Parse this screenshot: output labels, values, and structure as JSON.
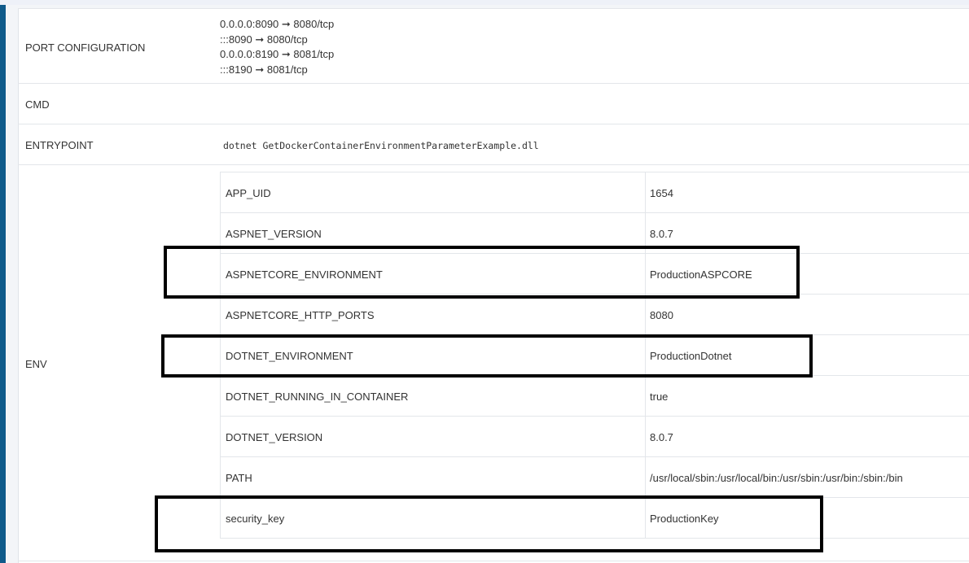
{
  "config": {
    "port_configuration": {
      "label": "PORT CONFIGURATION",
      "lines": [
        "0.0.0.0:8090 ➞ 8080/tcp",
        ":::8090 ➞ 8080/tcp",
        "0.0.0.0:8190 ➞ 8081/tcp",
        ":::8190 ➞ 8081/tcp"
      ]
    },
    "cmd": {
      "label": "CMD",
      "value": ""
    },
    "entrypoint": {
      "label": "ENTRYPOINT",
      "value": "dotnet GetDockerContainerEnvironmentParameterExample.dll"
    },
    "env": {
      "label": "ENV",
      "rows": [
        {
          "name": "APP_UID",
          "value": "1654"
        },
        {
          "name": "ASPNET_VERSION",
          "value": "8.0.7"
        },
        {
          "name": "ASPNETCORE_ENVIRONMENT",
          "value": "ProductionASPCORE"
        },
        {
          "name": "ASPNETCORE_HTTP_PORTS",
          "value": "8080"
        },
        {
          "name": "DOTNET_ENVIRONMENT",
          "value": "ProductionDotnet"
        },
        {
          "name": "DOTNET_RUNNING_IN_CONTAINER",
          "value": "true"
        },
        {
          "name": "DOTNET_VERSION",
          "value": "8.0.7"
        },
        {
          "name": "PATH",
          "value": "/usr/local/sbin:/usr/local/bin:/usr/sbin:/usr/bin:/sbin:/bin"
        },
        {
          "name": "security_key",
          "value": "ProductionKey"
        }
      ]
    }
  },
  "colors": {
    "sidebar_accent": "#0f5a8a",
    "border": "#e3e6ea",
    "highlight_box": "#000000"
  }
}
